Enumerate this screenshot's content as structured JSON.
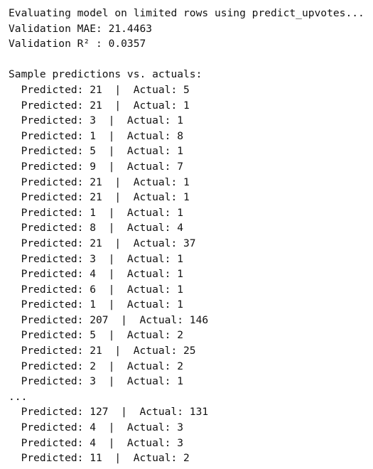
{
  "console": {
    "header": "Evaluating model on limited rows using predict_upvotes...",
    "mae": "Validation MAE: 21.4463",
    "r2": "Validation R² : 0.0357",
    "samples_title": "Sample predictions vs. actuals:",
    "ellipsis": "...",
    "predictions_first": [
      "  Predicted: 21  |  Actual: 5",
      "  Predicted: 21  |  Actual: 1",
      "  Predicted: 3  |  Actual: 1",
      "  Predicted: 1  |  Actual: 8",
      "  Predicted: 5  |  Actual: 1",
      "  Predicted: 9  |  Actual: 7",
      "  Predicted: 21  |  Actual: 1",
      "  Predicted: 21  |  Actual: 1",
      "  Predicted: 1  |  Actual: 1",
      "  Predicted: 8  |  Actual: 4",
      "  Predicted: 21  |  Actual: 37",
      "  Predicted: 3  |  Actual: 1",
      "  Predicted: 4  |  Actual: 1",
      "  Predicted: 6  |  Actual: 1",
      "  Predicted: 1  |  Actual: 1",
      "  Predicted: 207  |  Actual: 146",
      "  Predicted: 5  |  Actual: 2",
      "  Predicted: 21  |  Actual: 25",
      "  Predicted: 2  |  Actual: 2",
      "  Predicted: 3  |  Actual: 1"
    ],
    "predictions_last": [
      "  Predicted: 127  |  Actual: 131",
      "  Predicted: 4  |  Actual: 3",
      "  Predicted: 4  |  Actual: 3",
      "  Predicted: 11  |  Actual: 2"
    ]
  }
}
